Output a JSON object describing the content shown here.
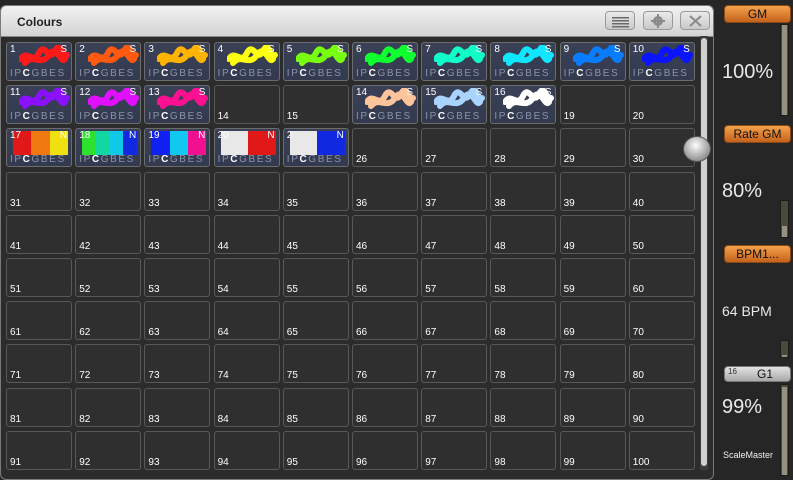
{
  "window": {
    "title": "Colours",
    "buttons": [
      "menu",
      "settings",
      "close"
    ]
  },
  "palettes": [
    {
      "num": "1",
      "flag": "S",
      "attrs": "IPCGBES",
      "colors": [
        "#ff1a1a"
      ]
    },
    {
      "num": "2",
      "flag": "S",
      "attrs": "IPCGBES",
      "colors": [
        "#ff5a10"
      ]
    },
    {
      "num": "3",
      "flag": "S",
      "attrs": "IPCGBES",
      "colors": [
        "#ffb400"
      ]
    },
    {
      "num": "4",
      "flag": "S",
      "attrs": "IPCGBES",
      "colors": [
        "#ffff10"
      ]
    },
    {
      "num": "5",
      "flag": "S",
      "attrs": "IPCGBES",
      "colors": [
        "#78ff10"
      ]
    },
    {
      "num": "6",
      "flag": "S",
      "attrs": "IPCGBES",
      "colors": [
        "#10ff30"
      ]
    },
    {
      "num": "7",
      "flag": "S",
      "attrs": "IPCGBES",
      "colors": [
        "#10ffc8"
      ]
    },
    {
      "num": "8",
      "flag": "S",
      "attrs": "IPCGBES",
      "colors": [
        "#10e6ff"
      ]
    },
    {
      "num": "9",
      "flag": "S",
      "attrs": "IPCGBES",
      "colors": [
        "#0a7cff"
      ]
    },
    {
      "num": "10",
      "flag": "S",
      "attrs": "IPCGBES",
      "colors": [
        "#0a14ff"
      ]
    },
    {
      "num": "11",
      "flag": "S",
      "attrs": "IPCGBES",
      "colors": [
        "#8a10ff"
      ]
    },
    {
      "num": "12",
      "flag": "S",
      "attrs": "IPCGBES",
      "colors": [
        "#e010ff"
      ]
    },
    {
      "num": "13",
      "flag": "S",
      "attrs": "IPCGBES",
      "colors": [
        "#ff1090"
      ]
    },
    {
      "num": "14"
    },
    {
      "num": "15"
    },
    {
      "num": "14",
      "flag": "S",
      "attrs": "IPCGBES",
      "colors": [
        "#ffc49a"
      ]
    },
    {
      "num": "15",
      "flag": "S",
      "attrs": "IPCGBES",
      "colors": [
        "#a8d4ff"
      ]
    },
    {
      "num": "16",
      "flag": "S",
      "attrs": "IPCGBES",
      "colors": [
        "#ffffff"
      ]
    },
    {
      "num": "19"
    },
    {
      "num": "20"
    },
    {
      "num": "17",
      "flag": "N",
      "attrs": "IPCGBES",
      "bars": [
        "#e01818",
        "#f07810",
        "#f0e010"
      ]
    },
    {
      "num": "18",
      "flag": "N",
      "attrs": "IPCGBES",
      "bars": [
        "#30e030",
        "#10d8a0",
        "#10c8e8",
        "#1028e0"
      ]
    },
    {
      "num": "19",
      "flag": "N",
      "attrs": "IPCGBES",
      "bars": [
        "#1020f0",
        "#10c8f0",
        "#f01090"
      ]
    },
    {
      "num": "20",
      "flag": "N",
      "attrs": "IPCGBES",
      "bars": [
        "#e8e8e8",
        "#e01818"
      ]
    },
    {
      "num": "2",
      "flag": "N",
      "attrs": "IPCGBES",
      "bars": [
        "#e8e8e8",
        "#1028e0"
      ]
    }
  ],
  "sidebar": {
    "gm": {
      "label": "GM",
      "value": "100%",
      "level": 1.0
    },
    "rate_gm": {
      "label": "Rate GM",
      "value": "80%",
      "level": 0.3
    },
    "bpm": {
      "label": "BPM1...",
      "value": "64 BPM",
      "level": 0.1
    },
    "group": {
      "number": "16",
      "label": "G1",
      "value": "99%",
      "level": 0.98,
      "caption": "ScaleMaster"
    }
  },
  "colors": {
    "accent_orange": "#e07a2a",
    "window_bg": "#2c2c2c",
    "cell_border": "#585858"
  }
}
